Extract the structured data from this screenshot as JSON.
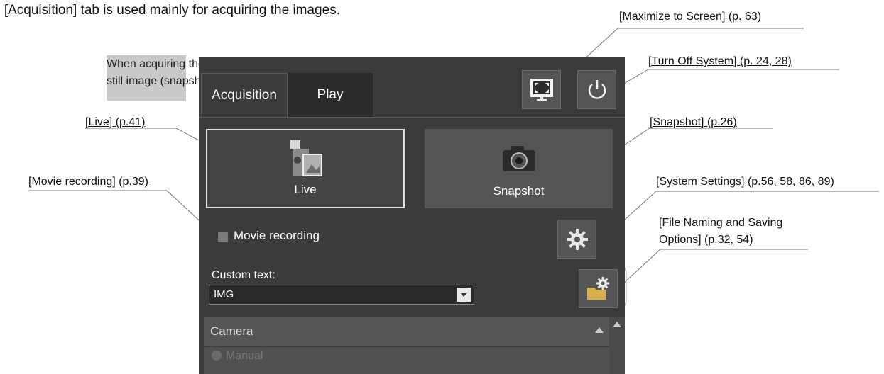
{
  "intro_text": "e [Acquisition] tab is used mainly for acquiring the images.",
  "callout": {
    "line1": "When acquiring the",
    "line2": "still image (snapshot)*"
  },
  "labels": {
    "maximize": "[Maximize to Screen] (p. 63)",
    "turn_off": "[Turn Off System] (p. 24, 28)",
    "live": "[Live] (p.41)",
    "snapshot": "[Snapshot] (p.26)",
    "movie": "[Movie recording] (p.39)",
    "system_settings": "[System Settings] (p.56, 58, 86, 89)",
    "file_naming_line1": "[File Naming and Saving",
    "file_naming_line2": "Options] (p.32, 54)"
  },
  "panel": {
    "tabs": [
      "Acquisition",
      "Play"
    ],
    "live_label": "Live",
    "snapshot_label": "Snapshot",
    "movie_label": "Movie recording",
    "custom_text_label": "Custom text:",
    "custom_text_value": "IMG",
    "camera_section": "Camera",
    "manual_option": "Manual"
  },
  "icons": {
    "maximize": "maximize-screen-icon",
    "power": "power-icon",
    "camcorder": "camcorder-icon",
    "camera": "camera-icon",
    "gear": "gear-icon",
    "folder_gear": "folder-gear-icon",
    "dropdown": "chevron-down-icon",
    "collapse": "chevron-up-icon"
  }
}
